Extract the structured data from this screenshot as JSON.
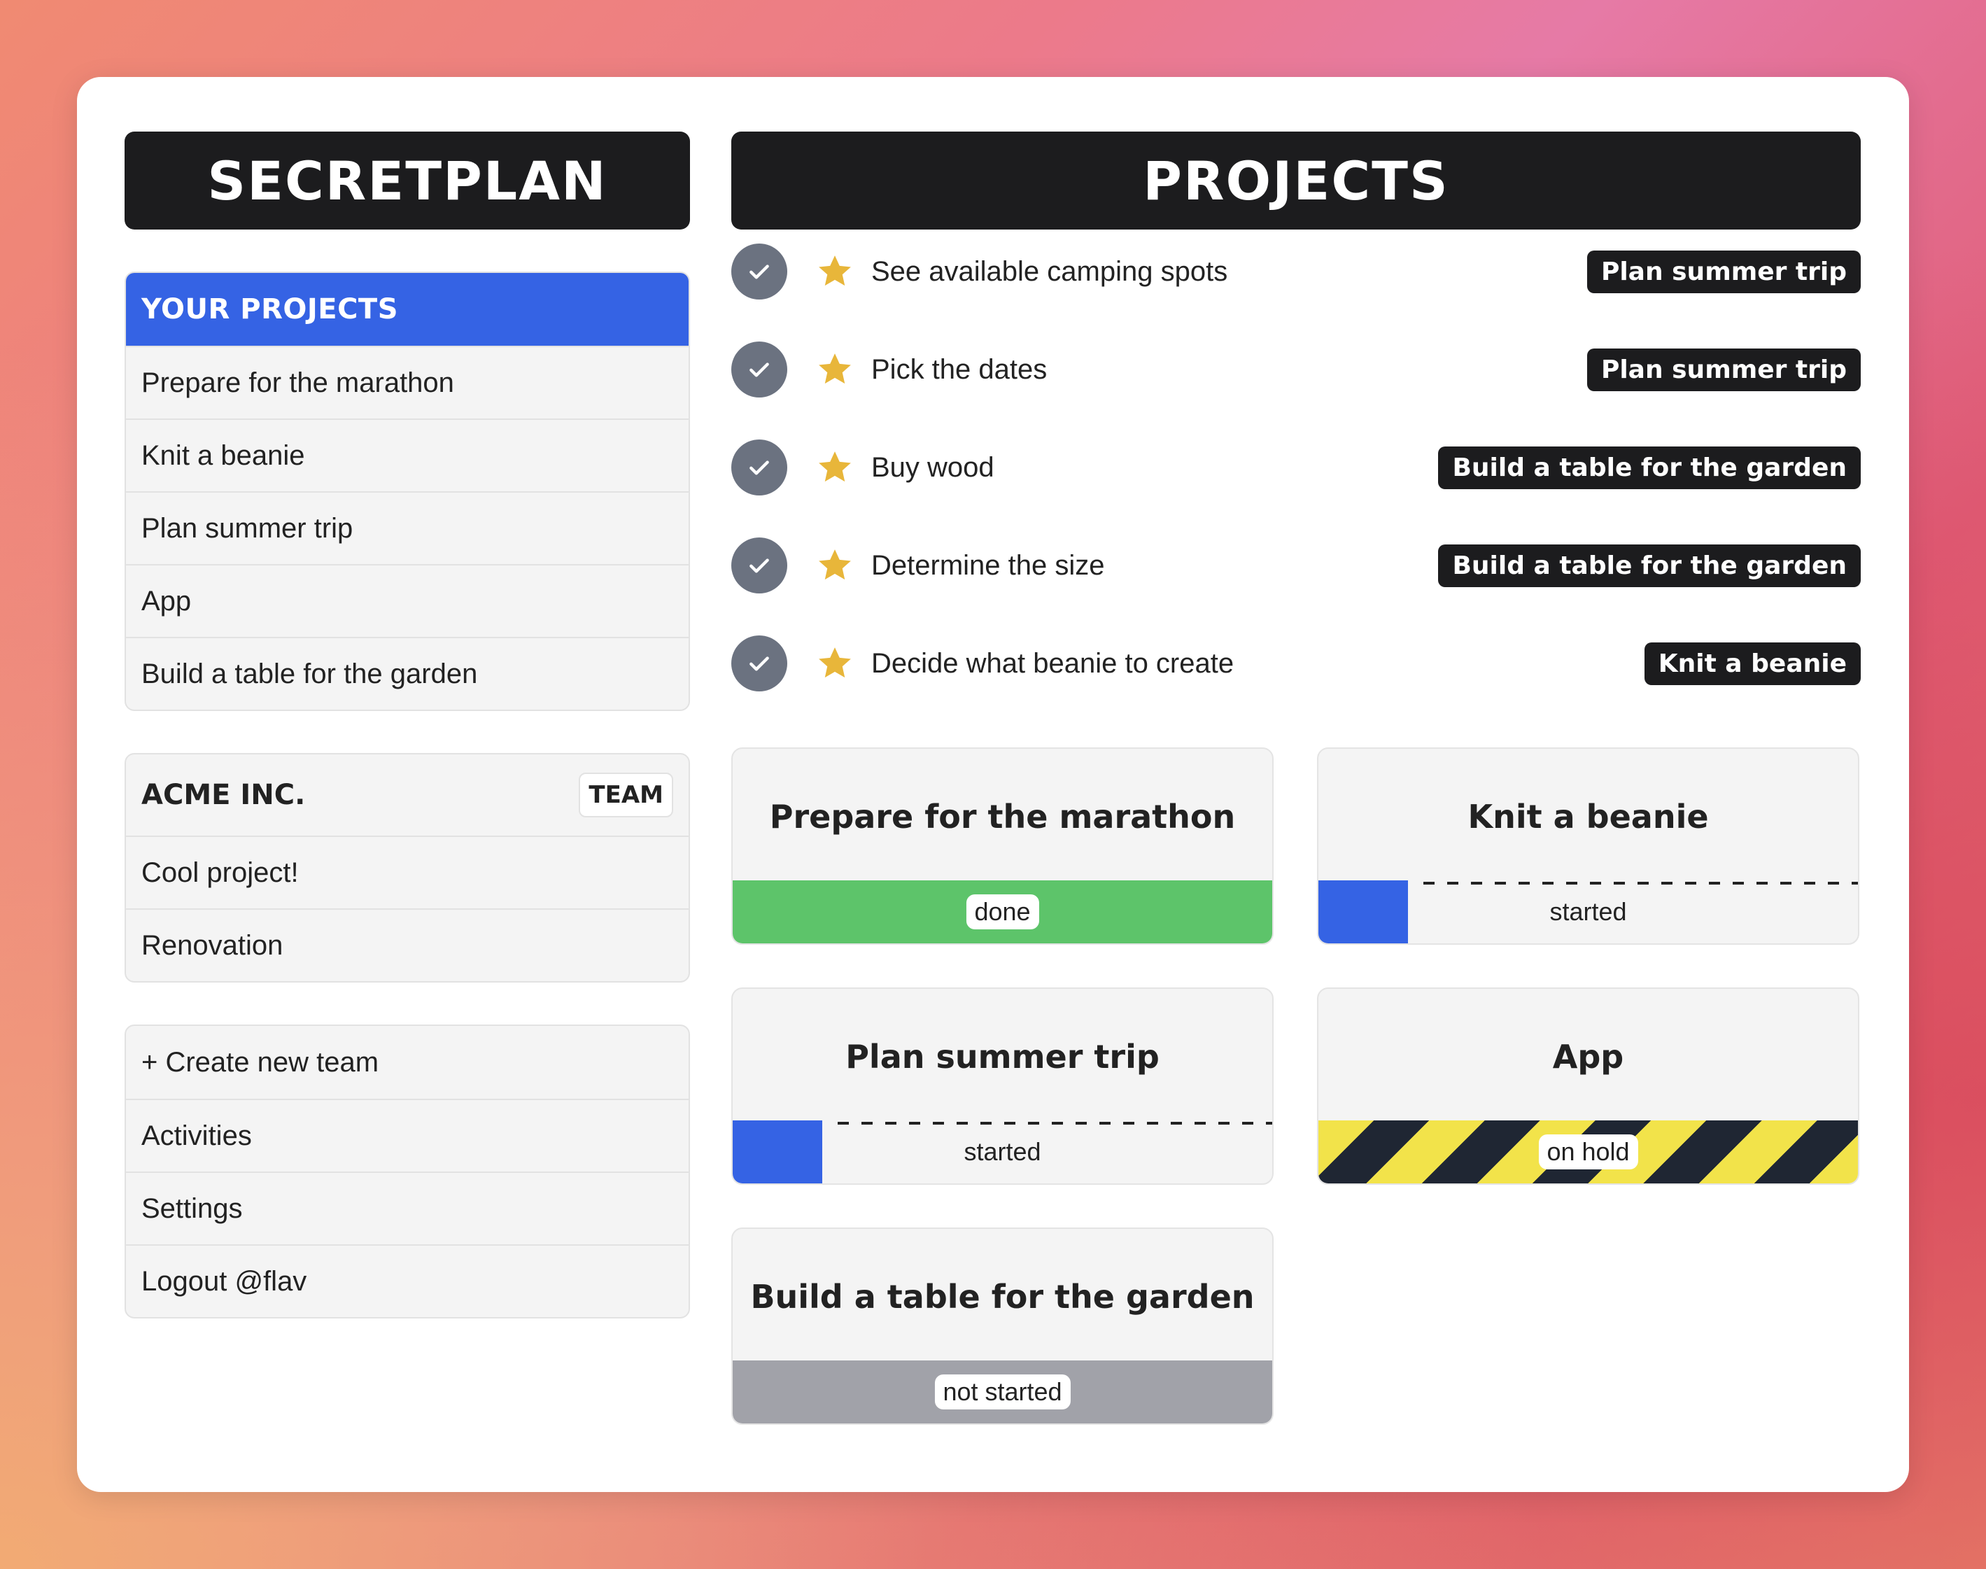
{
  "app": {
    "brand": "SECRETPLAN",
    "main_title": "PROJECTS"
  },
  "sidebar": {
    "your_projects": {
      "header": "YOUR PROJECTS",
      "items": [
        {
          "label": "Prepare for the marathon"
        },
        {
          "label": "Knit a beanie"
        },
        {
          "label": "Plan summer trip"
        },
        {
          "label": "App"
        },
        {
          "label": "Build a table for the garden"
        }
      ]
    },
    "team": {
      "name": "ACME INC.",
      "badge": "TEAM",
      "items": [
        {
          "label": "Cool project!"
        },
        {
          "label": "Renovation"
        }
      ]
    },
    "actions": [
      {
        "label": "+ Create new team"
      },
      {
        "label": "Activities"
      },
      {
        "label": "Settings"
      },
      {
        "label": "Logout @flav"
      }
    ]
  },
  "tasks": [
    {
      "text": "See available camping spots",
      "project": "Plan summer trip",
      "done": true,
      "starred": true
    },
    {
      "text": "Pick the dates",
      "project": "Plan summer trip",
      "done": true,
      "starred": true
    },
    {
      "text": "Buy wood",
      "project": "Build a table for the garden",
      "done": true,
      "starred": true
    },
    {
      "text": "Determine the size",
      "project": "Build a table for the garden",
      "done": true,
      "starred": true
    },
    {
      "text": "Decide what beanie to create",
      "project": "Knit a beanie",
      "done": true,
      "starred": true
    }
  ],
  "projects": [
    {
      "title": "Prepare for the marathon",
      "status": "done"
    },
    {
      "title": "Knit a beanie",
      "status": "started"
    },
    {
      "title": "Plan summer trip",
      "status": "started"
    },
    {
      "title": "App",
      "status": "on hold"
    },
    {
      "title": "Build a table for the garden",
      "status": "not started"
    }
  ],
  "colors": {
    "accent_blue": "#3563e4",
    "done_green": "#5dc46a",
    "not_started_gray": "#a1a2a9",
    "hold_yellow": "#f2e34a",
    "hold_dark": "#1f2633",
    "star_gold": "#e8b63a",
    "check_gray": "#6b7280"
  },
  "icons": {
    "task_check": "check-icon",
    "task_star": "star-icon"
  }
}
